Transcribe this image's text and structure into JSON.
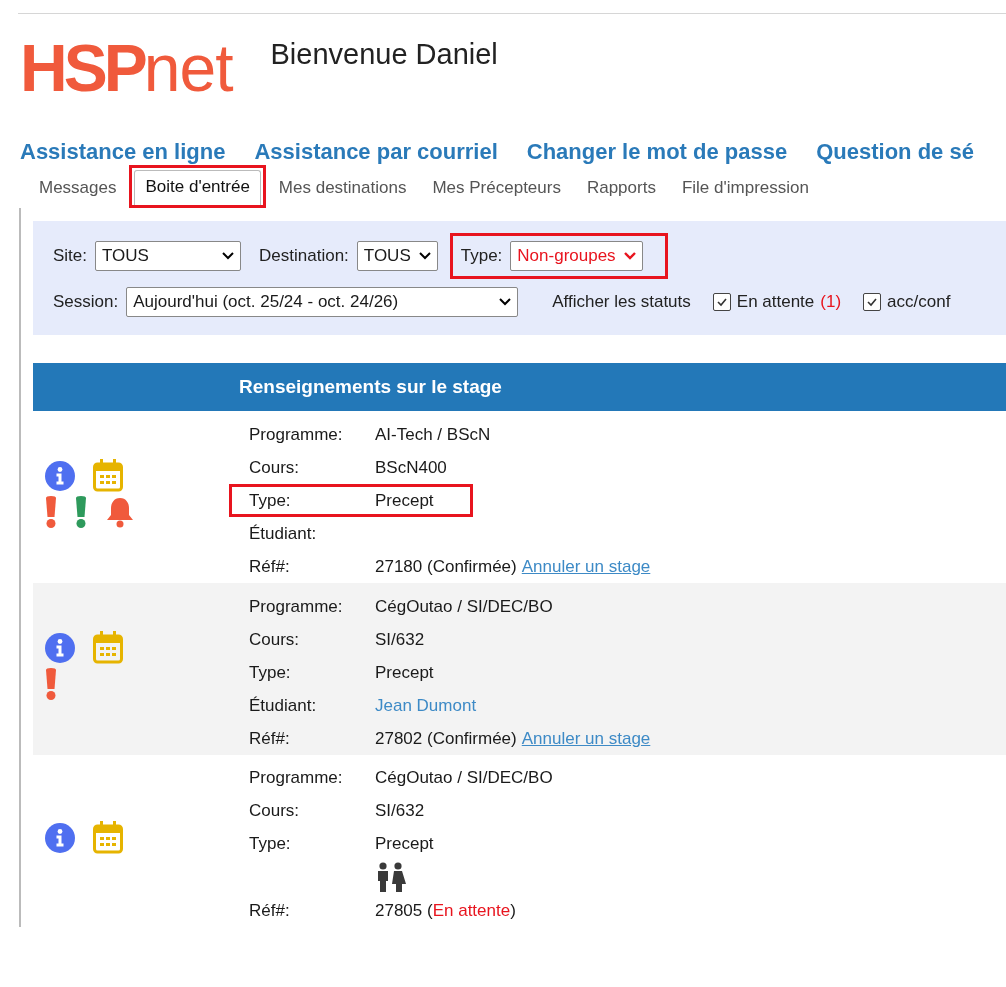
{
  "logo": {
    "main": "HSP",
    "suffix": "net"
  },
  "welcome": "Bienvenue Daniel",
  "links": [
    "Assistance en ligne",
    "Assistance par courriel",
    "Changer le mot de passe",
    "Question de sé"
  ],
  "tabs": [
    {
      "label": "Messages",
      "selected": false,
      "highlighted": false
    },
    {
      "label": "Boite d'entrée",
      "selected": true,
      "highlighted": true
    },
    {
      "label": "Mes destinations",
      "selected": false,
      "highlighted": false
    },
    {
      "label": "Mes Précepteurs",
      "selected": false,
      "highlighted": false
    },
    {
      "label": "Rapports",
      "selected": false,
      "highlighted": false
    },
    {
      "label": "File d'impression",
      "selected": false,
      "highlighted": false
    }
  ],
  "filters": {
    "site": {
      "label": "Site:",
      "value": "TOUS"
    },
    "destination": {
      "label": "Destination:",
      "value": "TOUS"
    },
    "type": {
      "label": "Type:",
      "value": "Non-groupes",
      "highlighted": true
    },
    "session": {
      "label": "Session:",
      "value": "Aujourd'hui (oct. 25/24 - oct. 24/26)"
    },
    "status_label": "Afficher les statuts",
    "statuses": [
      {
        "label": "En attente",
        "count": "(1)",
        "checked": true
      },
      {
        "label": "acc/conf",
        "checked": true
      }
    ]
  },
  "table": {
    "header": "Renseignements sur le stage",
    "rows": [
      {
        "icons": [
          {
            "kind": "info"
          },
          {
            "kind": "calendar"
          },
          {
            "kind": "alert",
            "color": "#f05a3c"
          },
          {
            "kind": "alert",
            "color": "#2e9a5c"
          },
          {
            "kind": "bell"
          }
        ],
        "fields": [
          {
            "kind": "text",
            "label": "Programme:",
            "value": "AI-Tech / BScN",
            "highlighted": false
          },
          {
            "kind": "text",
            "label": "Cours:",
            "value": "BScN400",
            "highlighted": false
          },
          {
            "kind": "text",
            "label": "Type:",
            "value": "Precept",
            "highlighted": true
          },
          {
            "kind": "text",
            "label": "Étudiant:",
            "highlighted": false
          },
          {
            "kind": "ref",
            "label": "Réf#:",
            "number": "27180",
            "status": "(Confirmée)",
            "pending": false,
            "link": "Annuler un stage",
            "highlighted": false
          }
        ]
      },
      {
        "icons": [
          {
            "kind": "info"
          },
          {
            "kind": "calendar"
          },
          {
            "kind": "alert",
            "color": "#f05a3c"
          }
        ],
        "fields": [
          {
            "kind": "text",
            "label": "Programme:",
            "value": "CégOutao / SI/DEC/BO",
            "highlighted": false
          },
          {
            "kind": "text",
            "label": "Cours:",
            "value": "SI/632",
            "highlighted": false
          },
          {
            "kind": "text",
            "label": "Type:",
            "value": "Precept",
            "highlighted": false
          },
          {
            "kind": "link",
            "label": "Étudiant:",
            "value": "Jean Dumont",
            "highlighted": false
          },
          {
            "kind": "ref",
            "label": "Réf#:",
            "number": "27802",
            "status": "(Confirmée)",
            "pending": false,
            "link": "Annuler un stage",
            "highlighted": false
          }
        ]
      },
      {
        "icons": [
          {
            "kind": "info"
          },
          {
            "kind": "calendar"
          }
        ],
        "fields": [
          {
            "kind": "text",
            "label": "Programme:",
            "value": "CégOutao / SI/DEC/BO",
            "highlighted": false
          },
          {
            "kind": "text",
            "label": "Cours:",
            "value": "SI/632",
            "highlighted": false
          },
          {
            "kind": "text",
            "label": "Type:",
            "value": "Precept",
            "highlighted": false
          },
          {
            "kind": "people",
            "highlighted": false
          },
          {
            "kind": "ref",
            "label": "Réf#:",
            "number": "27805",
            "status": "(En attente)",
            "pending": true,
            "highlighted": false
          }
        ]
      }
    ]
  }
}
